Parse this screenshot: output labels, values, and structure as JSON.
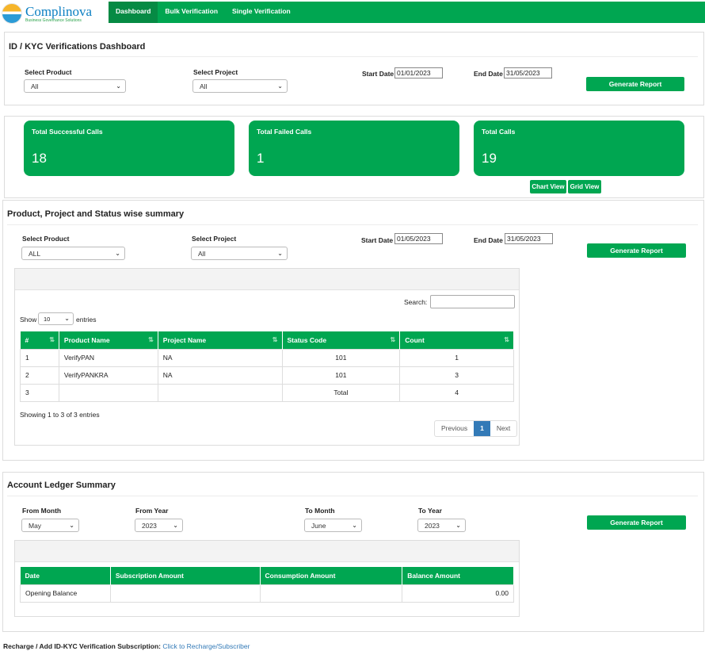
{
  "brand": {
    "name": "Complinova",
    "tagline": "Business Governance Solutions"
  },
  "nav": {
    "items": [
      "Dashboard",
      "Bulk Verification",
      "Single Verification"
    ],
    "active": "Dashboard"
  },
  "dashboard": {
    "title": "ID / KYC Verifications Dashboard",
    "select_product_label": "Select Product",
    "select_product_value": "All",
    "select_project_label": "Select Project",
    "select_project_value": "All",
    "start_date_label": "Start Date",
    "start_date_value": "01/01/2023",
    "end_date_label": "End Date",
    "end_date_value": "31/05/2023",
    "generate_label": "Generate Report"
  },
  "stats": {
    "successful": {
      "title": "Total Successful Calls",
      "value": "18"
    },
    "failed": {
      "title": "Total Failed Calls",
      "value": "1"
    },
    "total": {
      "title": "Total Calls",
      "value": "19"
    },
    "chart_view_label": "Chart View",
    "grid_view_label": "Grid View"
  },
  "summary": {
    "title": "Product, Project and Status wise summary",
    "select_product_label": "Select Product",
    "select_product_value": "ALL",
    "select_project_label": "Select Project",
    "select_project_value": "All",
    "start_date_label": "Start Date",
    "start_date_value": "01/05/2023",
    "end_date_label": "End Date",
    "end_date_value": "31/05/2023",
    "generate_label": "Generate Report",
    "search_label": "Search:",
    "show_label": "Show",
    "entries_value": "10",
    "entries_label": "entries",
    "columns": [
      "#",
      "Product Name",
      "Project Name",
      "Status Code",
      "Count"
    ],
    "rows": [
      [
        "1",
        "VerifyPAN",
        "NA",
        "101",
        "1"
      ],
      [
        "2",
        "VerifyPANKRA",
        "NA",
        "101",
        "3"
      ],
      [
        "3",
        "",
        "",
        "Total",
        "4"
      ]
    ],
    "info": "Showing 1 to 3 of 3 entries",
    "pager": {
      "previous": "Previous",
      "current": "1",
      "next": "Next"
    }
  },
  "ledger": {
    "title": "Account Ledger Summary",
    "from_month_label": "From Month",
    "from_month_value": "May",
    "from_year_label": "From Year",
    "from_year_value": "2023",
    "to_month_label": "To Month",
    "to_month_value": "June",
    "to_year_label": "To Year",
    "to_year_value": "2023",
    "generate_label": "Generate Report",
    "columns": [
      "Date",
      "Subscription Amount",
      "Consumption Amount",
      "Balance Amount"
    ],
    "rows": [
      [
        "Opening Balance",
        "",
        "",
        "0.00"
      ]
    ]
  },
  "footer": {
    "text": "Recharge / Add ID-KYC Verification Subscription:",
    "link": "Click to Recharge/Subscriber"
  }
}
